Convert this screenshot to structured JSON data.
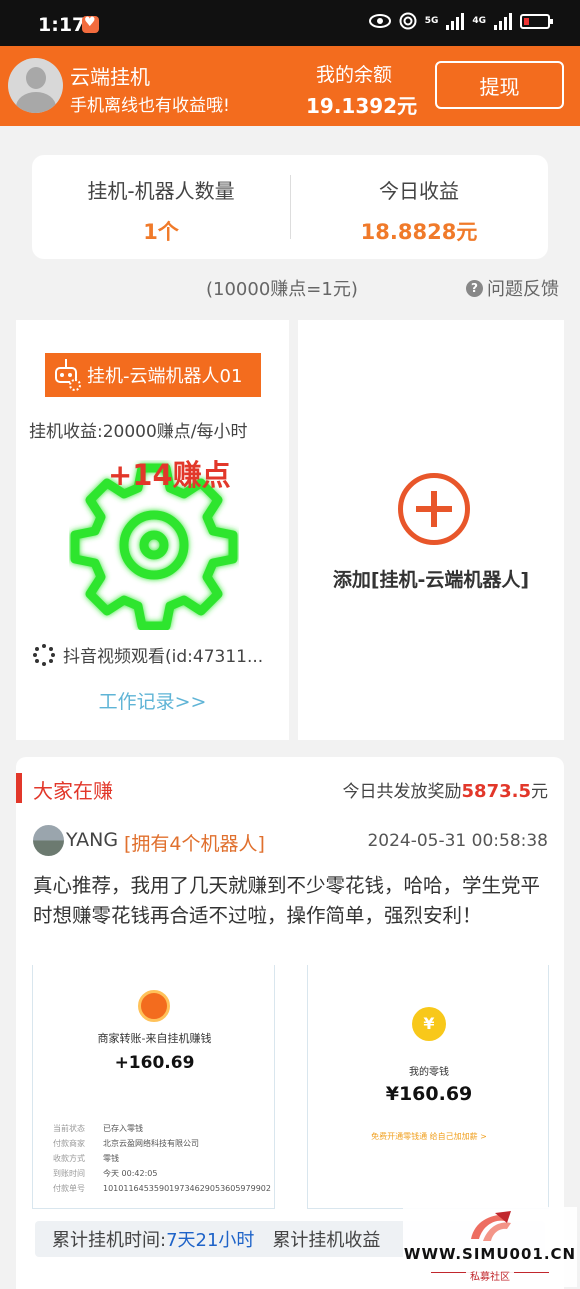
{
  "status_bar": {
    "time": "1:17",
    "net1": "5G",
    "net2": "4G"
  },
  "header": {
    "app_title": "云端挂机",
    "app_subtitle": "手机离线也有收益哦!",
    "balance_label": "我的余额",
    "balance_value": "19.1392元",
    "withdraw_label": "提现"
  },
  "stats": {
    "robots_label": "挂机-机器人数量",
    "robots_value": "1个",
    "today_label": "今日收益",
    "today_value": "18.8828元"
  },
  "rate_note": "(10000赚点=1元)",
  "feedback_label": "问题反馈",
  "robot_card": {
    "name": "挂机-云端机器人01",
    "earn_rate": "挂机收益:20000赚点/每小时",
    "points_popup": "+14赚点",
    "task": "抖音视频观看(id:47311...",
    "work_log": "工作记录>>"
  },
  "add_card": {
    "label": "添加[挂机-云端机器人]"
  },
  "feed": {
    "title": "大家在赚",
    "total_label": "今日共发放奖励",
    "total_value": "5873.5",
    "total_unit": "元",
    "post": {
      "user": "YANG",
      "badge": "[拥有4个机器人]",
      "time": "2024-05-31 00:58:38",
      "text": "真心推荐，我用了几天就赚到不少零花钱，哈哈，学生党平时想赚零花钱再合适不过啦，操作简单，强烈安利！",
      "shot1": {
        "title": "商家转账-来自挂机赚钱",
        "amount": "+160.69",
        "rows": [
          {
            "k": "当前状态",
            "v": "已存入零钱"
          },
          {
            "k": "付款商家",
            "v": "北京云盈网络科技有限公司"
          },
          {
            "k": "收款方式",
            "v": "零钱"
          },
          {
            "k": "到账时间",
            "v": "今天 00:42:05"
          },
          {
            "k": "付款单号",
            "v": "10101164535901973462905360597990​2"
          }
        ]
      },
      "shot2": {
        "coin": "¥",
        "title": "我的零钱",
        "amount": "¥160.69",
        "tip": "免费开通零钱通 给自己加加薪 >"
      }
    },
    "summary": {
      "time_label": "累计挂机时间:",
      "time_value": "7天21小时",
      "income_label": "累计挂机收益"
    }
  },
  "watermark": {
    "url": "WWW.SIMU001.CN",
    "sub": "私募社区"
  },
  "colors": {
    "brand": "#f36c1e",
    "accent_red": "#e2372a",
    "link": "#5fb4d6",
    "gear": "#2ee52e"
  }
}
